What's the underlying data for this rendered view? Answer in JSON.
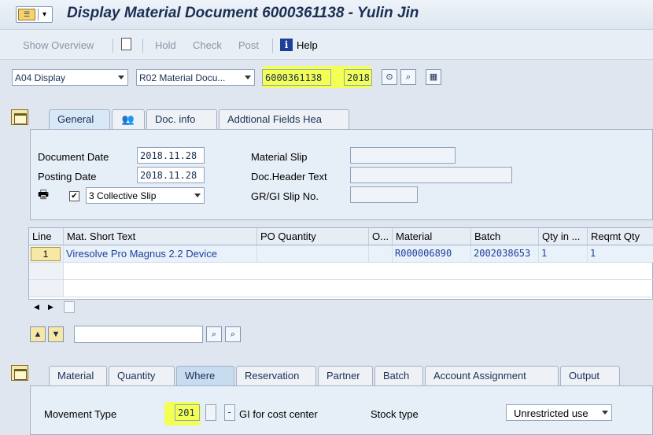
{
  "title": "Display Material Document 6000361138 - Yulin Jin",
  "toolbar": {
    "show_overview": "Show Overview",
    "hold": "Hold",
    "check": "Check",
    "post": "Post",
    "help": "Help"
  },
  "selection": {
    "action": "A04 Display",
    "reference": "R02 Material Docu...",
    "doc_number": "6000361138",
    "year": "2018"
  },
  "header_tabs": [
    "General",
    "Doc. info",
    "Addtional Fields Hea"
  ],
  "general": {
    "document_date_label": "Document Date",
    "document_date": "2018.11.28",
    "posting_date_label": "Posting Date",
    "posting_date": "2018.11.28",
    "slip_option": "3 Collective Slip",
    "material_slip_label": "Material Slip",
    "doc_header_text_label": "Doc.Header Text",
    "gr_gi_slip_label": "GR/GI Slip No."
  },
  "table": {
    "columns": [
      "Line",
      "Mat. Short Text",
      "PO Quantity",
      "O...",
      "Material",
      "Batch",
      "Qty in ...",
      "Reqmt Qty"
    ],
    "rows": [
      {
        "line": "1",
        "short_text": "Viresolve Pro Magnus 2.2 Device",
        "po_quantity": "",
        "o": "",
        "material": "R000006890",
        "batch": "2002038653",
        "qty_in": "1",
        "reqmt_qty": "1"
      }
    ]
  },
  "item_tabs": [
    "Material",
    "Quantity",
    "Where",
    "Reservation",
    "Partner",
    "Batch",
    "Account Assignment",
    "Output"
  ],
  "where": {
    "movement_type_label": "Movement Type",
    "movement_type": "201",
    "minus": "-",
    "gi_text": "GI for cost center",
    "stock_type_label": "Stock type",
    "stock_type": "Unrestricted use"
  }
}
